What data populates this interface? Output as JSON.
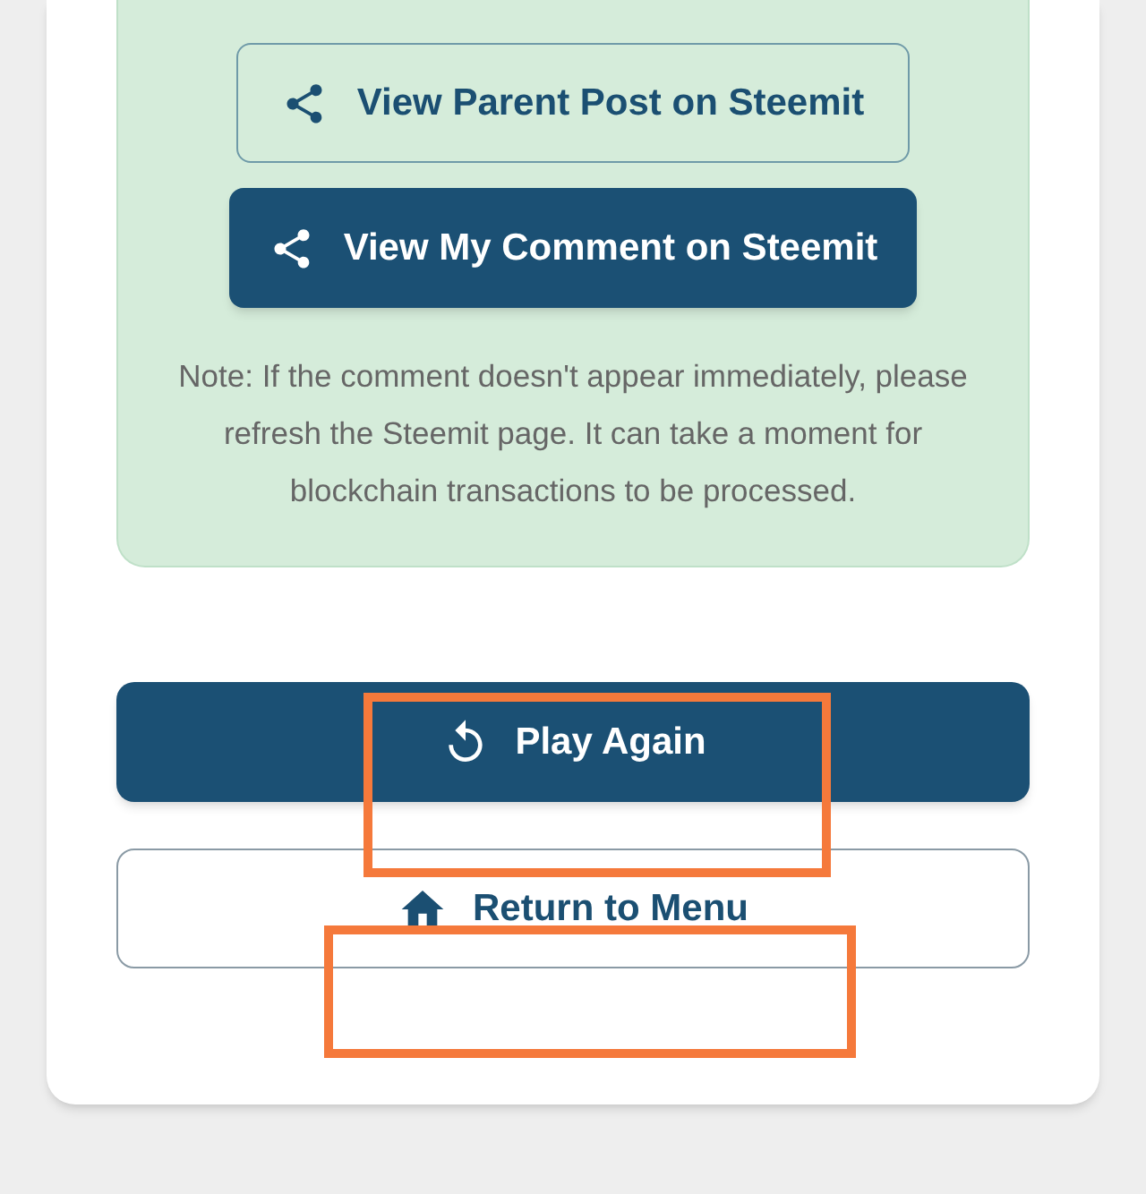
{
  "result_panel": {
    "buttons": [
      {
        "kind": "outline",
        "label": "View Parent Post on Steemit"
      },
      {
        "kind": "filled",
        "label": "View My Comment on Steemit"
      }
    ],
    "note": "Note: If the comment doesn't appear immediately, please refresh the Steemit page. It can take a moment for blockchain transactions to be processed."
  },
  "actions": [
    {
      "kind": "primary",
      "label": "Play Again"
    },
    {
      "kind": "secondary",
      "label": "Return to Menu"
    }
  ]
}
